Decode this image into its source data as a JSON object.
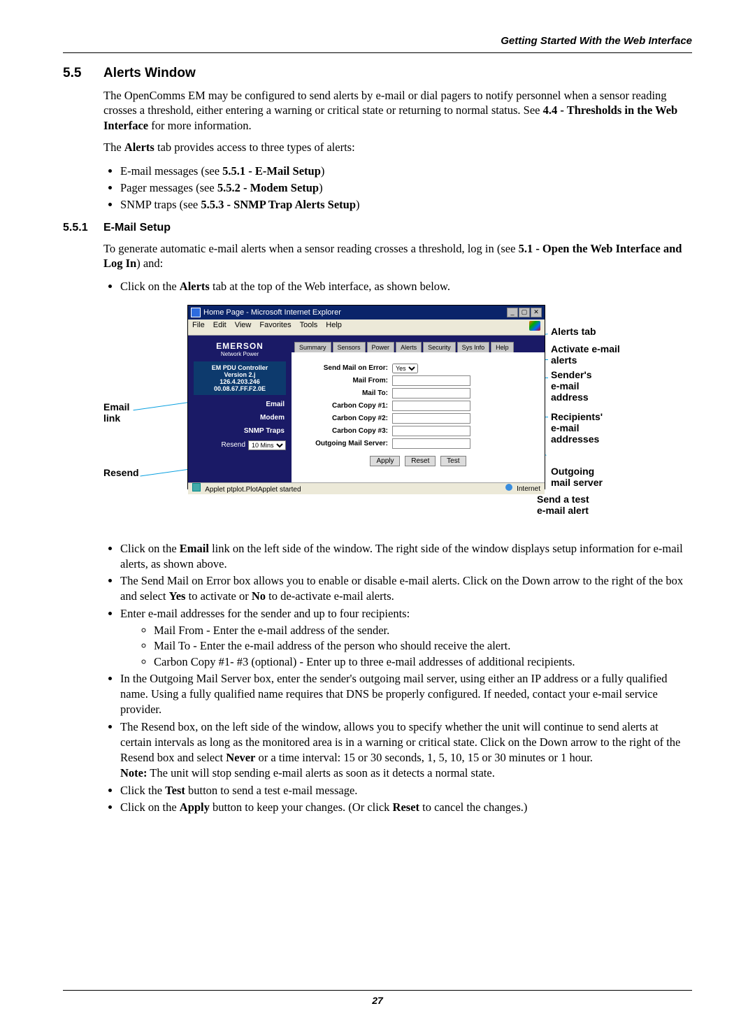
{
  "running_head": "Getting Started With the Web Interface",
  "sec55": {
    "num": "5.5",
    "title": "Alerts Window",
    "p1a": "The OpenComms EM may be configured to send alerts by e-mail or dial pagers to notify personnel when a sensor reading crosses a threshold, either entering a warning or critical state or returning to normal status. See ",
    "p1b": "4.4 - Thresholds in the Web Interface",
    "p1c": " for more information.",
    "p2a": "The ",
    "p2b": "Alerts",
    "p2c": " tab provides access to three types of alerts:",
    "b1a": "E-mail messages (see ",
    "b1b": "5.5.1 - E-Mail Setup",
    "b1c": ")",
    "b2a": "Pager messages (see ",
    "b2b": "5.5.2 - Modem Setup",
    "b2c": ")",
    "b3a": "SNMP traps (see ",
    "b3b": "5.5.3 - SNMP Trap Alerts Setup",
    "b3c": ")"
  },
  "sec551": {
    "num": "5.5.1",
    "title": "E-Mail Setup",
    "p1a": "To generate automatic e-mail alerts when a sensor reading crosses a threshold, log in (see ",
    "p1b": "5.1 - Open the Web Interface and Log In",
    "p1c": ") and:",
    "click_intro_a": "Click on the ",
    "click_intro_b": "Alerts",
    "click_intro_c": " tab at the top of the Web interface, as shown below."
  },
  "fig": {
    "title": "Home Page - Microsoft Internet Explorer",
    "menus": [
      "File",
      "Edit",
      "View",
      "Favorites",
      "Tools",
      "Help"
    ],
    "brand": "EMERSON",
    "brand_sub": "Network Power",
    "ident": [
      "EM PDU Controller",
      "Version 2.j",
      "126.4.203.246",
      "00.08.67.FF.F2.0E"
    ],
    "side_items": [
      "Email",
      "Modem",
      "SNMP Traps"
    ],
    "resend_label": "Resend",
    "resend_value": "10 Mins",
    "tabs": [
      "Summary",
      "Sensors",
      "Power",
      "Alerts",
      "Security",
      "Sys Info",
      "Help"
    ],
    "fields": [
      "Send Mail on Error:",
      "Mail From:",
      "Mail To:",
      "Carbon Copy #1:",
      "Carbon Copy #2:",
      "Carbon Copy #3:",
      "Outgoing Mail Server:"
    ],
    "send_select": "Yes",
    "buttons": [
      "Apply",
      "Reset",
      "Test"
    ],
    "status_left": "Applet ptplot.PlotApplet started",
    "status_right": "Internet",
    "callouts": {
      "email_link": "Email\nlink",
      "resend": "Resend",
      "alerts_tab": "Alerts tab",
      "activate": "Activate e-mail\nalerts",
      "sender": "Sender's\ne-mail\naddress",
      "recipients": "Recipients'\ne-mail\naddresses",
      "outgoing": "Outgoing\nmail server",
      "testalert": "Send a test\ne-mail alert"
    }
  },
  "post": {
    "li1a": "Click on the ",
    "li1b": "Email",
    "li1c": " link on the left side of the window. The right side of the window displays setup information for e-mail alerts, as shown above.",
    "li2a": "The Send Mail on Error box allows you to enable or disable e-mail alerts. Click on the Down arrow to the right of the box and select ",
    "li2b": "Yes",
    "li2c": " to activate or ",
    "li2d": "No",
    "li2e": " to de-activate e-mail alerts.",
    "li3": "Enter e-mail addresses for the sender and up to four recipients:",
    "li3a": "Mail From - Enter the e-mail address of the sender.",
    "li3b": "Mail To - Enter the e-mail address of the person who should receive the alert.",
    "li3c": "Carbon Copy #1- #3 (optional) - Enter up to three e-mail addresses of additional recipients.",
    "li4": "In the Outgoing Mail Server box, enter the sender's outgoing mail server, using either an IP address or a fully qualified name. Using a fully qualified name requires that DNS be properly configured. If needed, contact your e-mail service provider.",
    "li5a": "The Resend box, on the left side of the window, allows you to specify whether the unit will continue to send alerts at certain intervals as long as the monitored area is in a warning or critical state. Click on the Down arrow to the right of the Resend box and select ",
    "li5b": "Never",
    "li5c": " or a time interval: 15 or 30 seconds, 1, 5, 10, 15 or 30 minutes or 1 hour.",
    "li5_note_a": "Note:",
    "li5_note_b": " The unit will stop sending e-mail alerts as soon as it detects a normal state.",
    "li6a": "Click the ",
    "li6b": "Test",
    "li6c": " button to send a test e-mail message.",
    "li7a": "Click on the ",
    "li7b": "Apply",
    "li7c": " button to keep your changes. (Or click ",
    "li7d": "Reset",
    "li7e": " to cancel the changes.)"
  },
  "page_number": "27"
}
